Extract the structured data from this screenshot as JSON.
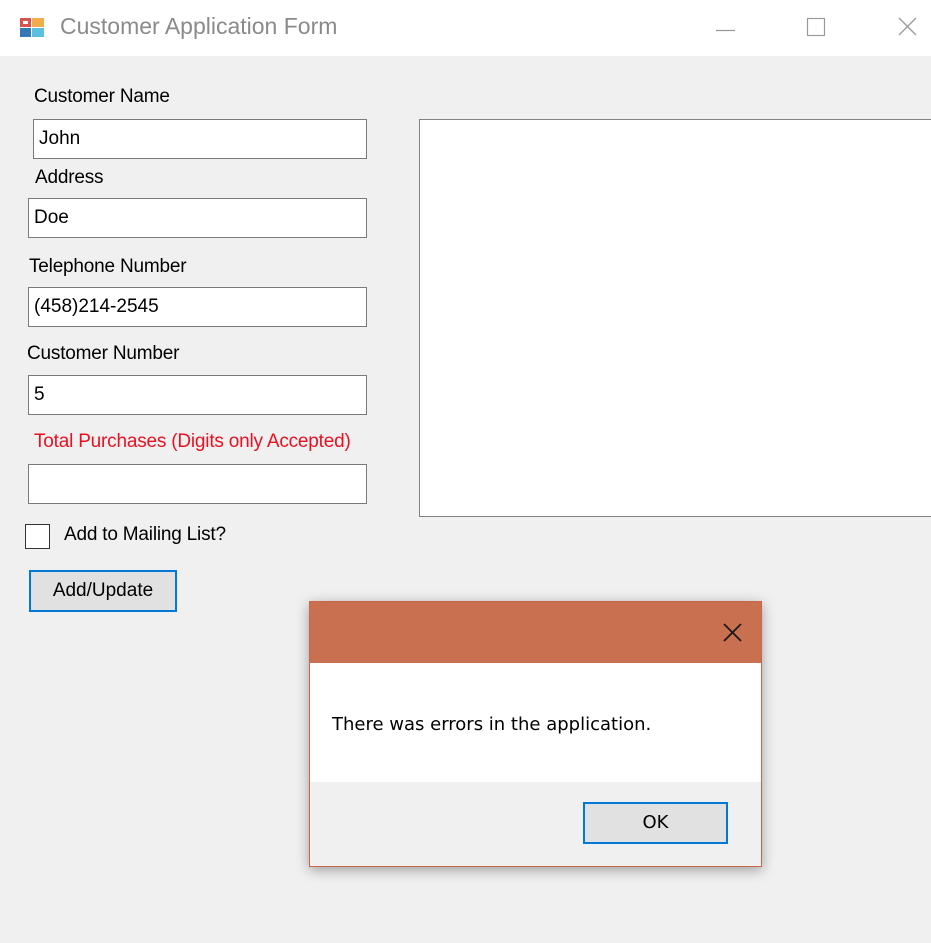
{
  "window": {
    "title": "Customer Application Form",
    "icon": "winforms-app-icon",
    "controls": {
      "minimize_icon": "minimize-icon",
      "maximize_icon": "maximize-icon",
      "close_icon": "close-icon"
    }
  },
  "form": {
    "customer_name": {
      "label": "Customer Name",
      "value": "John"
    },
    "address": {
      "label": "Address",
      "value": "Doe"
    },
    "telephone": {
      "label": "Telephone Number",
      "value": "(458)214-2545"
    },
    "customer_number": {
      "label": "Customer Number",
      "value": "5"
    },
    "total_purchases": {
      "label": "Total Purchases (Digits only Accepted)",
      "value": "",
      "label_color": "#e81123"
    },
    "mailing_list": {
      "label": "Add to Mailing List?",
      "checked": false
    },
    "add_update_label": "Add/Update"
  },
  "dialog": {
    "message": "There was errors in the application.",
    "ok_label": "OK",
    "titlebar_color": "#c8704f",
    "close_icon": "close-icon"
  },
  "colors": {
    "accent": "#0078d7",
    "window_bg": "#f0f0f0",
    "error": "#e81123"
  }
}
